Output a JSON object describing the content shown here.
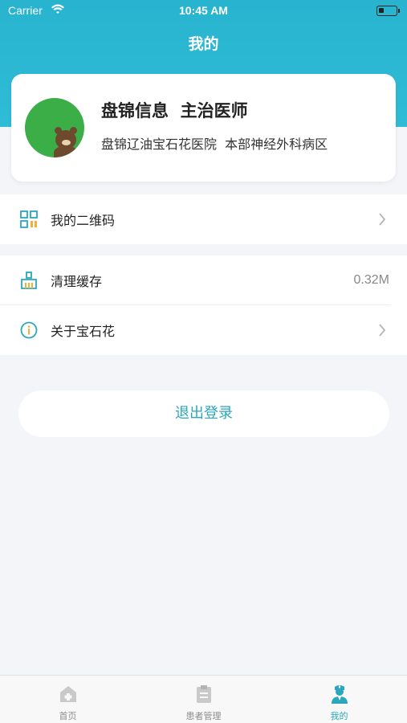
{
  "status_bar": {
    "carrier": "Carrier",
    "time": "10:45 AM"
  },
  "nav": {
    "title": "我的"
  },
  "profile": {
    "name": "盘锦信息  主治医师",
    "hospital": "盘锦辽油宝石花医院  本部神经外科病区"
  },
  "menu": {
    "qrcode_label": "我的二维码",
    "clear_cache_label": "清理缓存",
    "cache_size": "0.32M",
    "about_label": "关于宝石花"
  },
  "logout_label": "退出登录",
  "tabs": [
    {
      "label": "首页",
      "icon": "home-icon"
    },
    {
      "label": "患者管理",
      "icon": "clipboard-icon"
    },
    {
      "label": "我的",
      "icon": "doctor-icon"
    }
  ],
  "colors": {
    "header": "#28b4cf",
    "accent": "#2aa7bd",
    "background": "#f3f5f8"
  }
}
